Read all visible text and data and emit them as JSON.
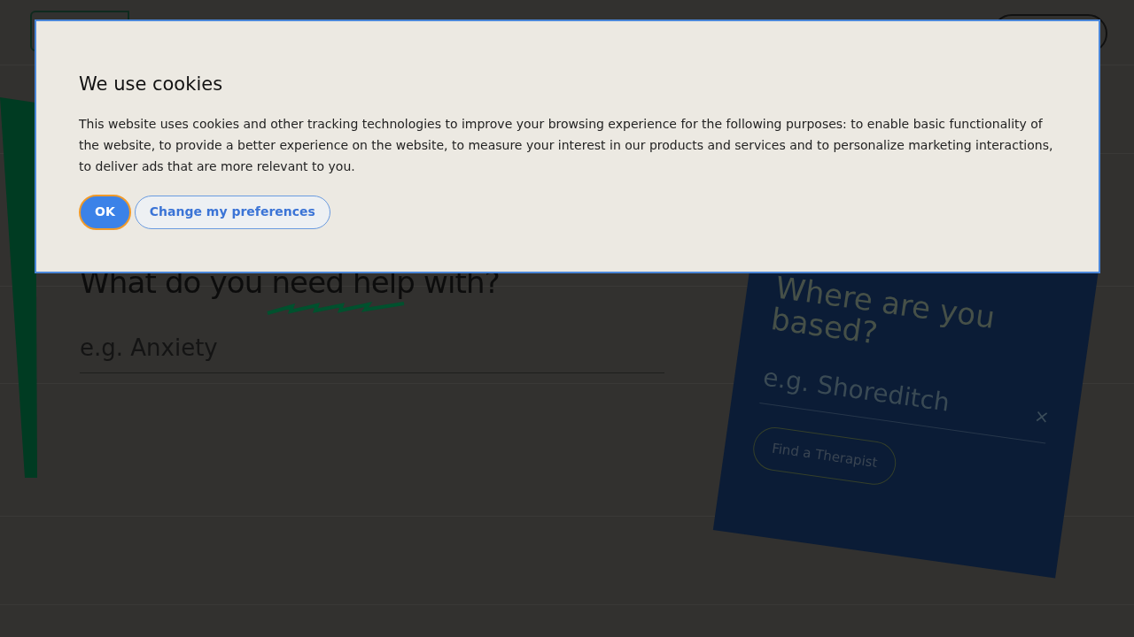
{
  "page": {
    "heading": "What do you need help with?",
    "search_placeholder": "e.g. Anxiety"
  },
  "location_card": {
    "heading": "Where are you based?",
    "placeholder": "e.g. Shoreditch",
    "clear": "×",
    "button": "Find a Therapist"
  },
  "cookie_dialog": {
    "title": "We use cookies",
    "text": "This website uses cookies and other tracking technologies to improve your browsing experience for the following purposes: to enable basic functionality of the website, to provide a better experience on the website, to measure your interest in our products and services and to personalize marketing interactions, to deliver ads that are more relevant to you.",
    "buttons": [
      {
        "label": "OK",
        "kind": "primary"
      },
      {
        "label": "Change my preferences",
        "kind": "secondary"
      }
    ]
  }
}
